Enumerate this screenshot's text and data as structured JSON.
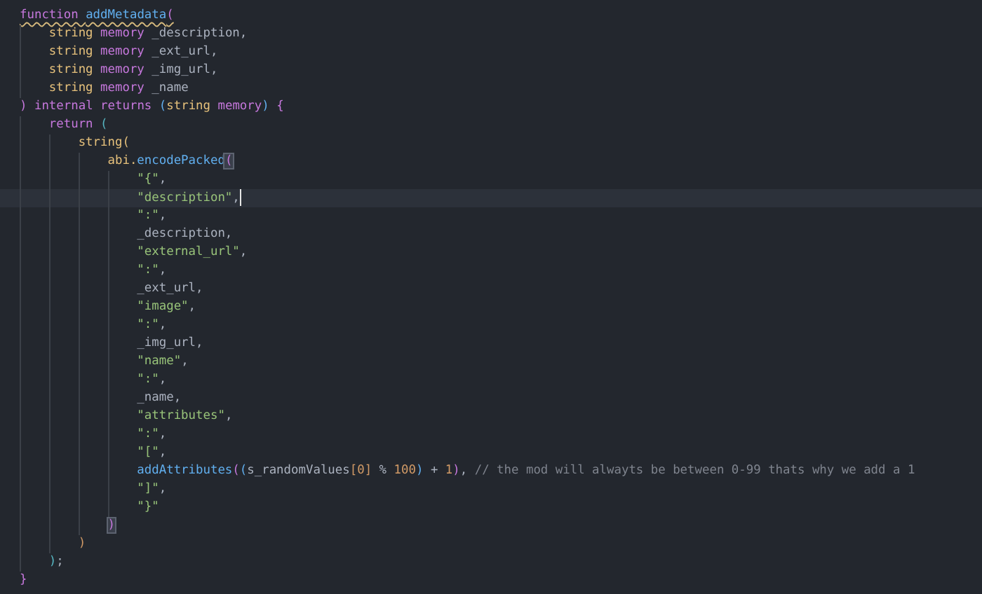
{
  "editor": {
    "lines": [
      {
        "tokens": [
          {
            "kind": "kw",
            "text": "function ",
            "warning": true
          },
          {
            "kind": "fn",
            "text": "addMetadata",
            "warning": true
          },
          {
            "kind": "bracket",
            "text": "(",
            "color": "#c678dd",
            "warning": true
          }
        ],
        "children": [
          {
            "tokens": [
              {
                "kind": "type",
                "text": "string"
              },
              {
                "kind": "kw",
                "text": " memory"
              },
              {
                "kind": "id",
                "text": " _description,"
              }
            ]
          },
          {
            "tokens": [
              {
                "kind": "type",
                "text": "string"
              },
              {
                "kind": "kw",
                "text": " memory"
              },
              {
                "kind": "id",
                "text": " _ext_url,"
              }
            ]
          },
          {
            "tokens": [
              {
                "kind": "type",
                "text": "string"
              },
              {
                "kind": "kw",
                "text": " memory"
              },
              {
                "kind": "id",
                "text": " _img_url,"
              }
            ]
          },
          {
            "tokens": [
              {
                "kind": "type",
                "text": "string"
              },
              {
                "kind": "kw",
                "text": " memory"
              },
              {
                "kind": "id",
                "text": " _name"
              }
            ]
          }
        ]
      },
      {
        "tokens": [
          {
            "kind": "bracket",
            "text": ")",
            "color": "#c678dd"
          },
          {
            "kind": "kw",
            "text": " internal returns "
          },
          {
            "kind": "bracket",
            "text": "(",
            "color": "#61afef"
          },
          {
            "kind": "type",
            "text": "string"
          },
          {
            "kind": "kw",
            "text": " memory"
          },
          {
            "kind": "bracket",
            "text": ")",
            "color": "#61afef"
          },
          {
            "kind": "bracket",
            "text": " {",
            "color": "#c678dd"
          }
        ],
        "children": [
          {
            "tokens": [
              {
                "kind": "kw",
                "text": "return "
              },
              {
                "kind": "bracket",
                "text": "(",
                "color": "#56b6c2"
              }
            ],
            "children": [
              {
                "tokens": [
                  {
                    "kind": "type",
                    "text": "string"
                  },
                  {
                    "kind": "bracket",
                    "text": "(",
                    "color": "#e5c07b"
                  }
                ],
                "children": [
                  {
                    "tokens": [
                      {
                        "kind": "type",
                        "text": "abi."
                      },
                      {
                        "kind": "fn",
                        "text": "encodePacked"
                      },
                      {
                        "kind": "bracket",
                        "text": "(",
                        "color": "#c678dd",
                        "matched": true
                      }
                    ],
                    "children": [
                      {
                        "tokens": [
                          {
                            "kind": "str",
                            "text": "\"{\""
                          },
                          {
                            "kind": "punc",
                            "text": ","
                          }
                        ]
                      },
                      {
                        "current": true,
                        "tokens": [
                          {
                            "kind": "str",
                            "text": "\"description\""
                          },
                          {
                            "kind": "punc",
                            "text": ",",
                            "caret": true
                          }
                        ]
                      },
                      {
                        "tokens": [
                          {
                            "kind": "str",
                            "text": "\":\""
                          },
                          {
                            "kind": "punc",
                            "text": ","
                          }
                        ]
                      },
                      {
                        "tokens": [
                          {
                            "kind": "id",
                            "text": "_description,"
                          }
                        ]
                      },
                      {
                        "tokens": [
                          {
                            "kind": "str",
                            "text": "\"external_url\""
                          },
                          {
                            "kind": "punc",
                            "text": ","
                          }
                        ]
                      },
                      {
                        "tokens": [
                          {
                            "kind": "str",
                            "text": "\":\""
                          },
                          {
                            "kind": "punc",
                            "text": ","
                          }
                        ]
                      },
                      {
                        "tokens": [
                          {
                            "kind": "id",
                            "text": "_ext_url,"
                          }
                        ]
                      },
                      {
                        "tokens": [
                          {
                            "kind": "str",
                            "text": "\"image\""
                          },
                          {
                            "kind": "punc",
                            "text": ","
                          }
                        ]
                      },
                      {
                        "tokens": [
                          {
                            "kind": "str",
                            "text": "\":\""
                          },
                          {
                            "kind": "punc",
                            "text": ","
                          }
                        ]
                      },
                      {
                        "tokens": [
                          {
                            "kind": "id",
                            "text": "_img_url,"
                          }
                        ]
                      },
                      {
                        "tokens": [
                          {
                            "kind": "str",
                            "text": "\"name\""
                          },
                          {
                            "kind": "punc",
                            "text": ","
                          }
                        ]
                      },
                      {
                        "tokens": [
                          {
                            "kind": "str",
                            "text": "\":\""
                          },
                          {
                            "kind": "punc",
                            "text": ","
                          }
                        ]
                      },
                      {
                        "tokens": [
                          {
                            "kind": "id",
                            "text": "_name,"
                          }
                        ]
                      },
                      {
                        "tokens": [
                          {
                            "kind": "str",
                            "text": "\"attributes\""
                          },
                          {
                            "kind": "punc",
                            "text": ","
                          }
                        ]
                      },
                      {
                        "tokens": [
                          {
                            "kind": "str",
                            "text": "\":\""
                          },
                          {
                            "kind": "punc",
                            "text": ","
                          }
                        ]
                      },
                      {
                        "tokens": [
                          {
                            "kind": "str",
                            "text": "\"[\""
                          },
                          {
                            "kind": "punc",
                            "text": ","
                          }
                        ]
                      },
                      {
                        "tokens": [
                          {
                            "kind": "fn",
                            "text": "addAttributes"
                          },
                          {
                            "kind": "bracket",
                            "text": "(",
                            "color": "#c678dd"
                          },
                          {
                            "kind": "bracket",
                            "text": "(",
                            "color": "#61afef"
                          },
                          {
                            "kind": "id",
                            "text": "s_randomValues"
                          },
                          {
                            "kind": "bracket",
                            "text": "[",
                            "color": "#d19a66"
                          },
                          {
                            "kind": "num",
                            "text": "0"
                          },
                          {
                            "kind": "bracket",
                            "text": "]",
                            "color": "#d19a66"
                          },
                          {
                            "kind": "punc",
                            "text": " % "
                          },
                          {
                            "kind": "num",
                            "text": "100"
                          },
                          {
                            "kind": "bracket",
                            "text": ")",
                            "color": "#61afef"
                          },
                          {
                            "kind": "punc",
                            "text": " + "
                          },
                          {
                            "kind": "num",
                            "text": "1"
                          },
                          {
                            "kind": "bracket",
                            "text": ")",
                            "color": "#c678dd"
                          },
                          {
                            "kind": "punc",
                            "text": ", "
                          },
                          {
                            "kind": "comment",
                            "text": "// the mod will alwayts be between 0-99 thats why we add a 1"
                          }
                        ]
                      },
                      {
                        "tokens": [
                          {
                            "kind": "str",
                            "text": "\"]\""
                          },
                          {
                            "kind": "punc",
                            "text": ","
                          }
                        ]
                      },
                      {
                        "tokens": [
                          {
                            "kind": "str",
                            "text": "\"}\""
                          }
                        ]
                      }
                    ]
                  },
                  {
                    "tokens": [
                      {
                        "kind": "bracket",
                        "text": ")",
                        "color": "#c678dd",
                        "matched": true
                      }
                    ]
                  }
                ]
              },
              {
                "tokens": [
                  {
                    "kind": "bracket",
                    "text": ")",
                    "color": "#d19a66"
                  }
                ]
              }
            ]
          },
          {
            "tokens": [
              {
                "kind": "bracket",
                "text": ")",
                "color": "#56b6c2"
              },
              {
                "kind": "punc",
                "text": ";"
              }
            ]
          }
        ]
      },
      {
        "tokens": [
          {
            "kind": "bracket",
            "text": "}",
            "color": "#c678dd"
          }
        ]
      }
    ]
  }
}
